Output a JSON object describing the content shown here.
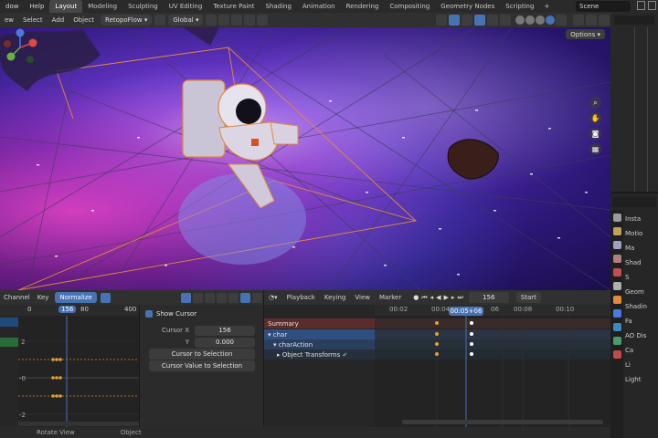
{
  "menubar": {
    "items": [
      "dow",
      "Help"
    ],
    "workspaces": [
      "Layout",
      "Modeling",
      "Sculpting",
      "UV Editing",
      "Texture Paint",
      "Shading",
      "Animation",
      "Rendering",
      "Compositing",
      "Geometry Nodes",
      "Scripting"
    ],
    "active_workspace": "Layout",
    "scene": "Scene"
  },
  "viewport_header": {
    "view": "ew",
    "select": "Select",
    "add": "Add",
    "object": "Object",
    "addon_menu": "RetopoFlow",
    "orientation": "Global",
    "options": "Options"
  },
  "graph_editor": {
    "menus": [
      "Channel",
      "Key"
    ],
    "normalize": "Normalize",
    "ruler": [
      "0",
      "156",
      "80",
      "400"
    ],
    "y_labels": [
      "2",
      "-0",
      "-2"
    ],
    "current_frame": "156"
  },
  "npanel": {
    "show_cursor": "Show Cursor",
    "cursor_x_label": "Cursor X",
    "cursor_x": "156",
    "y_label": "Y",
    "y_value": "0.000",
    "btn_cursor_to_selection": "Cursor to Selection",
    "btn_cursor_value": "Cursor Value to Selection"
  },
  "dopesheet": {
    "menus": [
      "Playback",
      "Keying",
      "View",
      "Marker"
    ],
    "frame": "156",
    "start": "Start",
    "ruler": [
      "00:02",
      "00:04",
      "00:05+06",
      "06",
      "00:08",
      "00:10"
    ],
    "summary": "Summary",
    "obj": "char",
    "action": "charAction",
    "group": "Object Transforms"
  },
  "right_panel": {
    "props_rows": [
      "Insta",
      "Motio",
      "Ma",
      "Shad",
      "S",
      "Geom",
      "Shadin",
      "Fa",
      "AO Dis",
      "Ca",
      "Li",
      "Light"
    ]
  },
  "statusbar": {
    "left": "Rotate View",
    "mid": "Object"
  }
}
